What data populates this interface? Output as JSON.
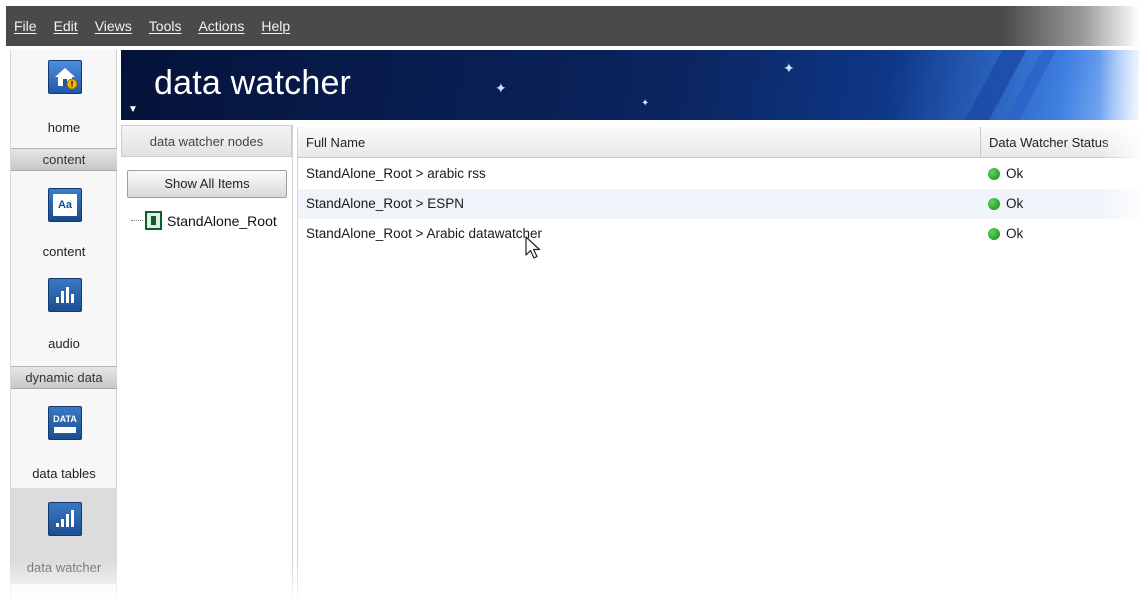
{
  "menubar": {
    "items": [
      "File",
      "Edit",
      "Views",
      "Tools",
      "Actions",
      "Help"
    ]
  },
  "nav": {
    "home": {
      "label": "home",
      "icon": "home-warning-icon"
    },
    "section_content": "content",
    "content": {
      "label": "content",
      "icon": "aa-text-icon"
    },
    "audio": {
      "label": "audio",
      "icon": "audio-equalizer-icon"
    },
    "section_dynamic": "dynamic data",
    "data_tables": {
      "label": "data tables",
      "icon": "data-table-icon",
      "icon_text": "DATA"
    },
    "data_watcher": {
      "label": "data watcher",
      "icon": "bar-chart-icon"
    }
  },
  "banner": {
    "title": "data watcher"
  },
  "tree": {
    "header": "data watcher nodes",
    "show_all_label": "Show All Items",
    "root_label": "StandAlone_Root"
  },
  "grid": {
    "columns": [
      "Full Name",
      "Data Watcher Status"
    ],
    "rows": [
      {
        "name": "StandAlone_Root > arabic rss",
        "status": "Ok"
      },
      {
        "name": "StandAlone_Root > ESPN",
        "status": "Ok"
      },
      {
        "name": "StandAlone_Root > Arabic datawatcher",
        "status": "Ok"
      }
    ]
  },
  "colors": {
    "menubar": "#4a4a4a",
    "banner_dark": "#05133a",
    "status_ok": "#1ea01e",
    "row_alt": "#f0f4fa"
  }
}
